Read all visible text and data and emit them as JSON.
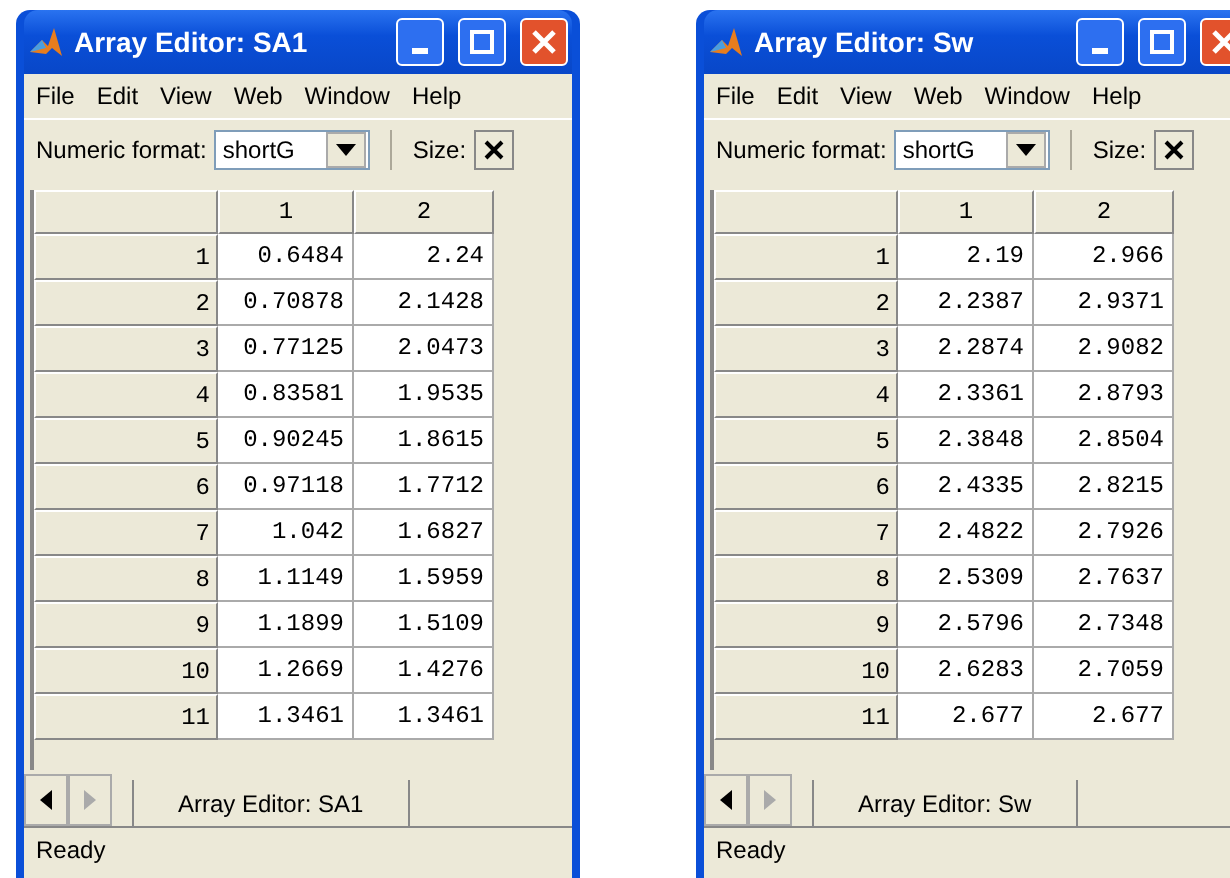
{
  "windows": [
    {
      "title": "Array Editor: SA1",
      "menu": [
        "File",
        "Edit",
        "View",
        "Web",
        "Window",
        "Help"
      ],
      "format_label": "Numeric format:",
      "format_value": "shortG",
      "size_label": "Size:",
      "columns": [
        "1",
        "2"
      ],
      "rows": [
        {
          "index": "1",
          "values": [
            "0.6484",
            "2.24"
          ]
        },
        {
          "index": "2",
          "values": [
            "0.70878",
            "2.1428"
          ]
        },
        {
          "index": "3",
          "values": [
            "0.77125",
            "2.0473"
          ]
        },
        {
          "index": "4",
          "values": [
            "0.83581",
            "1.9535"
          ]
        },
        {
          "index": "5",
          "values": [
            "0.90245",
            "1.8615"
          ]
        },
        {
          "index": "6",
          "values": [
            "0.97118",
            "1.7712"
          ]
        },
        {
          "index": "7",
          "values": [
            "1.042",
            "1.6827"
          ]
        },
        {
          "index": "8",
          "values": [
            "1.1149",
            "1.5959"
          ]
        },
        {
          "index": "9",
          "values": [
            "1.1899",
            "1.5109"
          ]
        },
        {
          "index": "10",
          "values": [
            "1.2669",
            "1.4276"
          ]
        },
        {
          "index": "11",
          "values": [
            "1.3461",
            "1.3461"
          ]
        }
      ],
      "tab": "Array Editor: SA1",
      "status": "Ready"
    },
    {
      "title": "Array Editor: Sw",
      "menu": [
        "File",
        "Edit",
        "View",
        "Web",
        "Window",
        "Help"
      ],
      "format_label": "Numeric format:",
      "format_value": "shortG",
      "size_label": "Size:",
      "columns": [
        "1",
        "2"
      ],
      "rows": [
        {
          "index": "1",
          "values": [
            "2.19",
            "2.966"
          ]
        },
        {
          "index": "2",
          "values": [
            "2.2387",
            "2.9371"
          ]
        },
        {
          "index": "3",
          "values": [
            "2.2874",
            "2.9082"
          ]
        },
        {
          "index": "4",
          "values": [
            "2.3361",
            "2.8793"
          ]
        },
        {
          "index": "5",
          "values": [
            "2.3848",
            "2.8504"
          ]
        },
        {
          "index": "6",
          "values": [
            "2.4335",
            "2.8215"
          ]
        },
        {
          "index": "7",
          "values": [
            "2.4822",
            "2.7926"
          ]
        },
        {
          "index": "8",
          "values": [
            "2.5309",
            "2.7637"
          ]
        },
        {
          "index": "9",
          "values": [
            "2.5796",
            "2.7348"
          ]
        },
        {
          "index": "10",
          "values": [
            "2.6283",
            "2.7059"
          ]
        },
        {
          "index": "11",
          "values": [
            "2.677",
            "2.677"
          ]
        }
      ],
      "tab": "Array Editor: Sw",
      "status": "Ready"
    }
  ]
}
